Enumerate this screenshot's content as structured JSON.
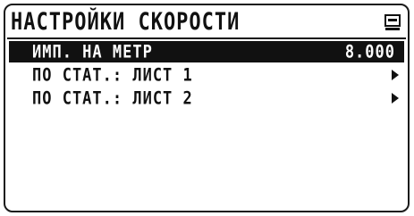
{
  "screen": {
    "title": "НАСТРОЙКИ СКОРОСТИ",
    "exit_icon": "exit-icon"
  },
  "menu": {
    "items": [
      {
        "label": "ИМП. НА МЕТР",
        "value": "8.000",
        "selected": true
      },
      {
        "label": "ПО СТАТ.: ЛИСТ 1",
        "icon": "arrow-right-icon",
        "selected": false
      },
      {
        "label": "ПО СТАТ.: ЛИСТ 2",
        "icon": "arrow-right-icon",
        "selected": false
      }
    ]
  }
}
